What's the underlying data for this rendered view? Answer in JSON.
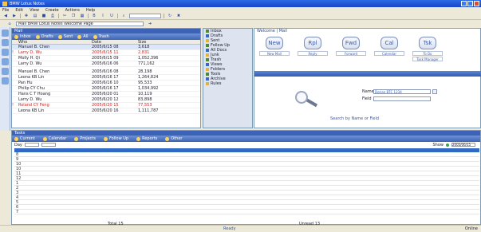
{
  "window": {
    "title": "BMW Lotus Notes"
  },
  "menubar": [
    "File",
    "Edit",
    "View",
    "Create",
    "Actions",
    "Help"
  ],
  "address": {
    "value": "Mail BMW Lotus Notes Welcome Page"
  },
  "mail_panel": {
    "title": "Mail",
    "tabs": [
      "Inbox",
      "Drafts",
      "Sent",
      "All",
      "Trash"
    ],
    "columns": [
      "",
      "Who",
      "Date",
      "Size",
      ""
    ],
    "rows": [
      {
        "who": "Manuel B. Chen",
        "date": "2005/6/15 08",
        "size": "3,618",
        "flag": ""
      },
      {
        "who": "Larry D. Wu",
        "date": "2005/6/15 11",
        "size": "2,831",
        "flag": "!"
      },
      {
        "who": "Molly H. Qi",
        "date": "2005/6/15 09",
        "size": "1,052,396",
        "flag": ""
      },
      {
        "who": "Larry D. Wu",
        "date": "2005/6/16 06",
        "size": "771,162",
        "flag": ""
      },
      {
        "who": "Manuel B. Chen",
        "date": "2005/6/16 08",
        "size": "28,198",
        "flag": ""
      },
      {
        "who": "Leona KB Lin",
        "date": "2005/6/16 17",
        "size": "1,264,824",
        "flag": ""
      },
      {
        "who": "Pan Hu",
        "date": "2005/6/16 10",
        "size": "95,533",
        "flag": ""
      },
      {
        "who": "Philip CY Chu",
        "date": "2005/6/16 17",
        "size": "1,034,992",
        "flag": ""
      },
      {
        "who": "Hans C T Hoang",
        "date": "2005/6/20 01",
        "size": "10,119",
        "flag": ""
      },
      {
        "who": "Larry D. Wu",
        "date": "2005/6/20 12",
        "size": "83,898",
        "flag": ""
      },
      {
        "who": "Roland CY Feng",
        "date": "2005/6/20 15",
        "size": "77,553",
        "flag": "!"
      },
      {
        "who": "Leona KB Lin",
        "date": "2005/6/20 16",
        "size": "1,111,787",
        "flag": ""
      }
    ]
  },
  "tree": {
    "items": [
      "Inbox",
      "Drafts",
      "Sent",
      "Follow Up",
      "All Docs",
      "Junk",
      "Trash",
      "Views",
      "Folders",
      "Tools",
      "Archive",
      "Rules"
    ]
  },
  "function_panel": {
    "title": "Welcome | Mail",
    "buttons": [
      {
        "icon": "New",
        "label": "New Mail",
        "sublabel": ""
      },
      {
        "icon": "Rpl",
        "label": "Reply",
        "sublabel": ""
      },
      {
        "icon": "Fwd",
        "label": "Forward",
        "sublabel": ""
      },
      {
        "icon": "Cal",
        "label": "Calendar",
        "sublabel": ""
      },
      {
        "icon": "Tsk",
        "label": "To Do",
        "sublabel": "Task Manager"
      }
    ],
    "search": {
      "name_label": "Name",
      "name_value": "Dorian BTC 1234",
      "field_label": "Field",
      "field_value": "",
      "footer": "Search by Name or Field"
    }
  },
  "task_panel": {
    "title": "Tasks",
    "tabs": [
      "Current",
      "Calendar",
      "Projects",
      "Follow Up",
      "Reports",
      "Other"
    ],
    "filter_label": "Day",
    "right_label": "Show",
    "right_value": "2005/06/15",
    "hours": [
      "8",
      "9",
      "10",
      "10",
      "11",
      "12",
      "1",
      "2",
      "3",
      "4",
      "5",
      "6",
      "7"
    ],
    "footer_left": "Total 15",
    "footer_right": "Unread 13"
  },
  "statusbar": {
    "center": "Ready",
    "right": "Online"
  }
}
